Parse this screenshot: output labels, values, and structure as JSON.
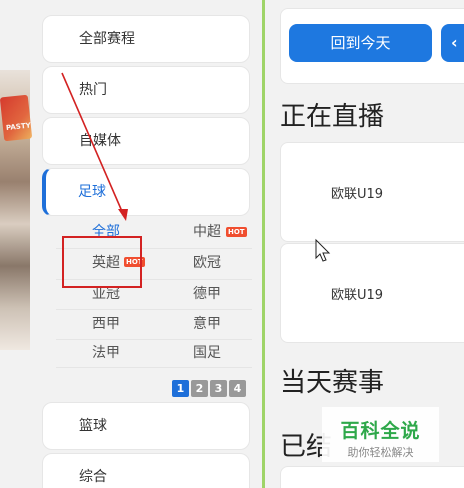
{
  "sidebar": {
    "items": [
      {
        "label": "全部赛程"
      },
      {
        "label": "热门"
      },
      {
        "label": "自媒体"
      },
      {
        "label": "足球"
      },
      {
        "label": "篮球"
      },
      {
        "label": "综合"
      }
    ],
    "active": "足球",
    "photo_logo_text": "PASTY"
  },
  "football_leagues": [
    {
      "label": "全部",
      "hot": false,
      "selected": true
    },
    {
      "label": "中超",
      "hot": true
    },
    {
      "label": "英超",
      "hot": true
    },
    {
      "label": "欧冠",
      "hot": false
    },
    {
      "label": "亚冠",
      "hot": false
    },
    {
      "label": "德甲",
      "hot": false
    },
    {
      "label": "西甲",
      "hot": false
    },
    {
      "label": "意甲",
      "hot": false
    },
    {
      "label": "法甲",
      "hot": false
    },
    {
      "label": "国足",
      "hot": false
    }
  ],
  "hot_badge": "HOT",
  "pagination": {
    "pages": [
      "1",
      "2",
      "3",
      "4"
    ],
    "current": "1"
  },
  "main": {
    "today_button": "回到今天",
    "live_title": "正在直播",
    "today_title": "当天赛事",
    "ended_title": "已结",
    "live_matches": [
      {
        "league": "欧联U19"
      },
      {
        "league": "欧联U19"
      }
    ]
  },
  "watermark": {
    "main": "百科全说",
    "sub": "助你轻松解决"
  },
  "colors": {
    "accent": "#1e78e0",
    "divider": "#9fd468",
    "annotation": "#d32222",
    "hot": "#f04e2f"
  }
}
